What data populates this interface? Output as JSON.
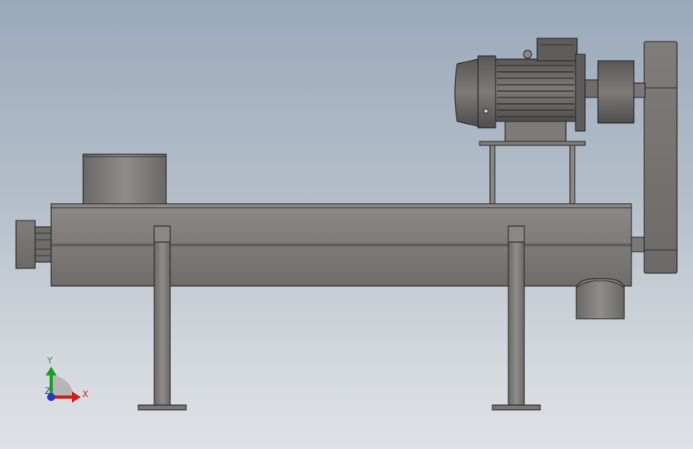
{
  "viewport": {
    "background_top": "#9aa9bb",
    "background_bottom": "#dfe2e5",
    "model_color": "#7c7a79"
  },
  "triad": {
    "x_label": "X",
    "y_label": "Y",
    "z_label": "Z",
    "x_color": "#cc1f1f",
    "y_color": "#1f9d2a",
    "z_color": "#2b35c8"
  }
}
